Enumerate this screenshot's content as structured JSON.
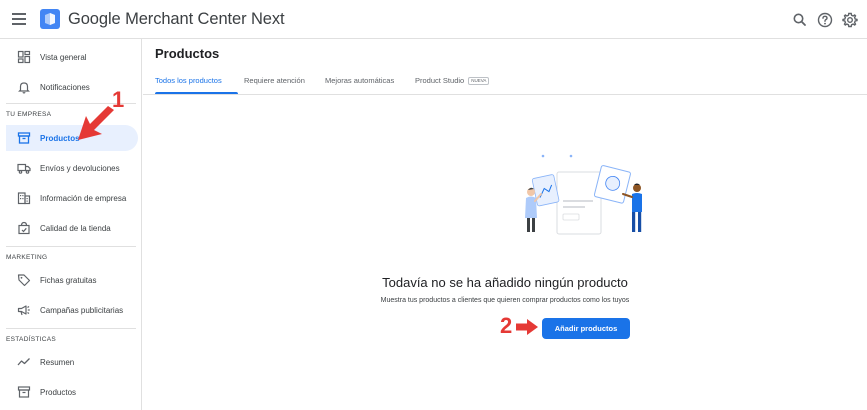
{
  "header": {
    "app_title": "Google Merchant Center Next"
  },
  "sidebar": {
    "items_top": [
      {
        "label": "Vista general",
        "icon": "dashboard-icon"
      },
      {
        "label": "Notificaciones",
        "icon": "bell-icon"
      }
    ],
    "section_business": "TU EMPRESA",
    "items_business": [
      {
        "label": "Productos",
        "icon": "archive-icon",
        "active": true
      },
      {
        "label": "Envíos y devoluciones",
        "icon": "truck-icon"
      },
      {
        "label": "Información de empresa",
        "icon": "building-icon"
      },
      {
        "label": "Calidad de la tienda",
        "icon": "shopping-bag-icon"
      }
    ],
    "section_marketing": "MARKETING",
    "items_marketing": [
      {
        "label": "Fichas gratuitas",
        "icon": "tag-icon"
      },
      {
        "label": "Campañas publicitarias",
        "icon": "megaphone-icon"
      }
    ],
    "section_stats": "ESTADÍSTICAS",
    "items_stats": [
      {
        "label": "Resumen",
        "icon": "trend-icon"
      },
      {
        "label": "Productos",
        "icon": "archive-icon"
      }
    ]
  },
  "main": {
    "title": "Productos",
    "tabs": [
      {
        "label": "Todos los productos",
        "active": true
      },
      {
        "label": "Requiere atención"
      },
      {
        "label": "Mejoras automáticas"
      },
      {
        "label": "Product Studio",
        "badge": "NUEVA"
      }
    ],
    "empty_title": "Todavía no se ha añadido ningún producto",
    "empty_subtitle": "Muestra tus productos a clientes que quieren comprar productos como los tuyos",
    "add_button": "Añadir productos"
  },
  "annotations": {
    "step1": "1",
    "step2": "2"
  },
  "colors": {
    "accent": "#1a73e8",
    "active_nav_bg": "#e8f0fe",
    "annotation": "#e53935"
  }
}
